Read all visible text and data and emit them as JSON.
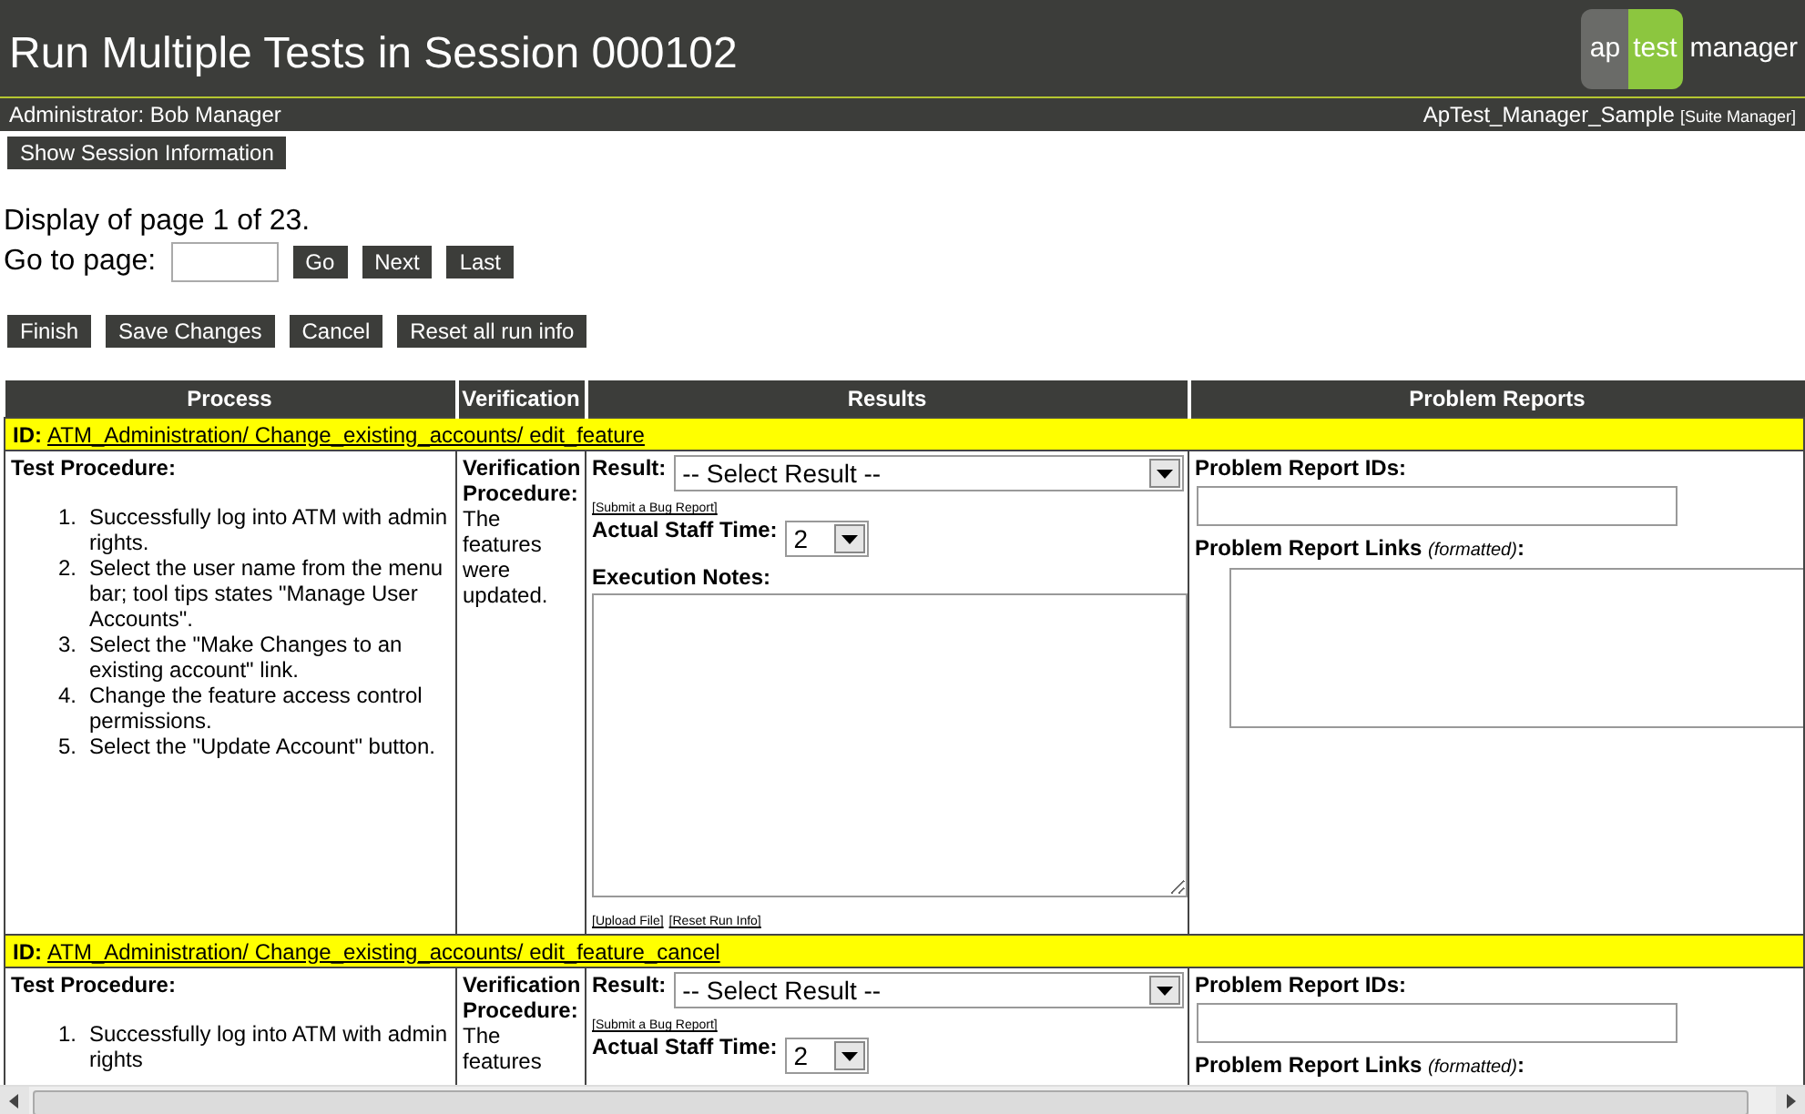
{
  "header": {
    "title": "Run Multiple Tests in Session 000102",
    "logo": {
      "part_1": "ap",
      "part_2": "test",
      "part_3": "manager"
    }
  },
  "user_bar": {
    "user": "Administrator: Bob Manager",
    "project": "ApTest_Manager_Sample",
    "project_link": "[Suite Manager]"
  },
  "session_button": "Show Session Information",
  "pagination": {
    "status": "Display of page 1 of 23.",
    "goto_label": "Go to page:",
    "buttons": [
      "Go",
      "Next",
      "Last"
    ]
  },
  "actions": [
    "Finish",
    "Save Changes",
    "Cancel",
    "Reset all run info"
  ],
  "table": {
    "columns": [
      "Process",
      "Verification",
      "Results",
      "Problem Reports"
    ],
    "tests": [
      {
        "id_label": "ID:",
        "id": "ATM_Administration/ Change_existing_accounts/ edit_feature",
        "procedure_label": "Test Procedure:",
        "steps": [
          {
            "number": "1.",
            "text": "Successfully log into ATM with admin rights."
          },
          {
            "number": "2.",
            "text": "Select the user name from the menu bar; tool tips states \"Manage User Accounts\"."
          },
          {
            "number": "3.",
            "text": "Select the \"Make Changes to an existing account\" link."
          },
          {
            "number": "4.",
            "text": "Change the feature access control permissions."
          },
          {
            "number": "5.",
            "text": "Select the \"Update Account\" button."
          }
        ],
        "verification_label": "Verification Procedure:",
        "verification": "The features were updated.",
        "result_label": "Result:",
        "result_value": "-- Select Result --",
        "bug_link": "[Submit a Bug Report]",
        "staff_label": "Actual Staff Time:",
        "staff_value": "2",
        "notes_label": "Execution Notes:",
        "file_links": [
          "[Upload File]",
          "[Reset Run Info]"
        ],
        "pr_ids_label": "Problem Report IDs:",
        "pr_links_label": "Problem Report Links *(formatted)*:",
        "pr_links_box": true
      },
      {
        "id_label": "ID:",
        "id": "ATM_Administration/ Change_existing_accounts/ edit_feature_cancel",
        "procedure_label": "Test Procedure:",
        "steps": [
          {
            "number": "1.",
            "text": "Successfully log into ATM with admin rights"
          }
        ],
        "verification_label": "Verification Procedure:",
        "verification": "The features",
        "result_label": "Result:",
        "result_value": "-- Select Result --",
        "bug_link": "[Submit a Bug Report]",
        "staff_label": "Actual Staff Time:",
        "staff_value": "2",
        "pr_ids_label": "Problem Report IDs:",
        "pr_links_label": "Problem Report Links *(formatted)*:"
      }
    ]
  }
}
